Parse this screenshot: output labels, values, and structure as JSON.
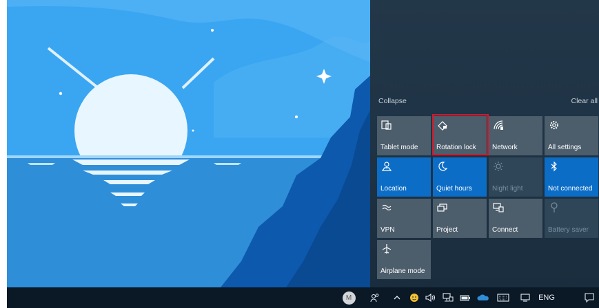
{
  "colors": {
    "sky": "#3aa6f2",
    "tile_on": "#0c6dc7",
    "tile_off": "#4c5d6c",
    "tile_disabled": "#2e4658",
    "panel_bg": "#1e3345",
    "taskbar_bg": "#0b1826",
    "highlight": "#d8182a"
  },
  "action_center": {
    "collapse_label": "Collapse",
    "clear_all_label": "Clear all",
    "tiles": [
      {
        "label": "Tablet mode",
        "icon": "tablet-mode-icon",
        "state": "off"
      },
      {
        "label": "Rotation lock",
        "icon": "rotation-lock-icon",
        "state": "off",
        "highlighted": true
      },
      {
        "label": "Network",
        "icon": "network-icon",
        "state": "off"
      },
      {
        "label": "All settings",
        "icon": "gear-icon",
        "state": "off"
      },
      {
        "label": "Location",
        "icon": "location-icon",
        "state": "on"
      },
      {
        "label": "Quiet hours",
        "icon": "moon-icon",
        "state": "on"
      },
      {
        "label": "Night light",
        "icon": "sun-icon",
        "state": "disabled"
      },
      {
        "label": "Not connected",
        "icon": "bluetooth-icon",
        "state": "on"
      },
      {
        "label": "VPN",
        "icon": "vpn-icon",
        "state": "off"
      },
      {
        "label": "Project",
        "icon": "project-icon",
        "state": "off"
      },
      {
        "label": "Connect",
        "icon": "connect-icon",
        "state": "off"
      },
      {
        "label": "Battery saver",
        "icon": "battery-saver-icon",
        "state": "disabled"
      },
      {
        "label": "Airplane mode",
        "icon": "airplane-icon",
        "state": "off"
      }
    ]
  },
  "taskbar": {
    "avatar_initial": "M",
    "language": "ENG",
    "tray_icons": [
      "people-icon",
      "chevron-up-icon",
      "emoji-icon",
      "volume-icon",
      "network-tray-icon",
      "battery-icon",
      "onedrive-icon",
      "keyboard-icon",
      "display-icon",
      "notification-icon"
    ]
  }
}
